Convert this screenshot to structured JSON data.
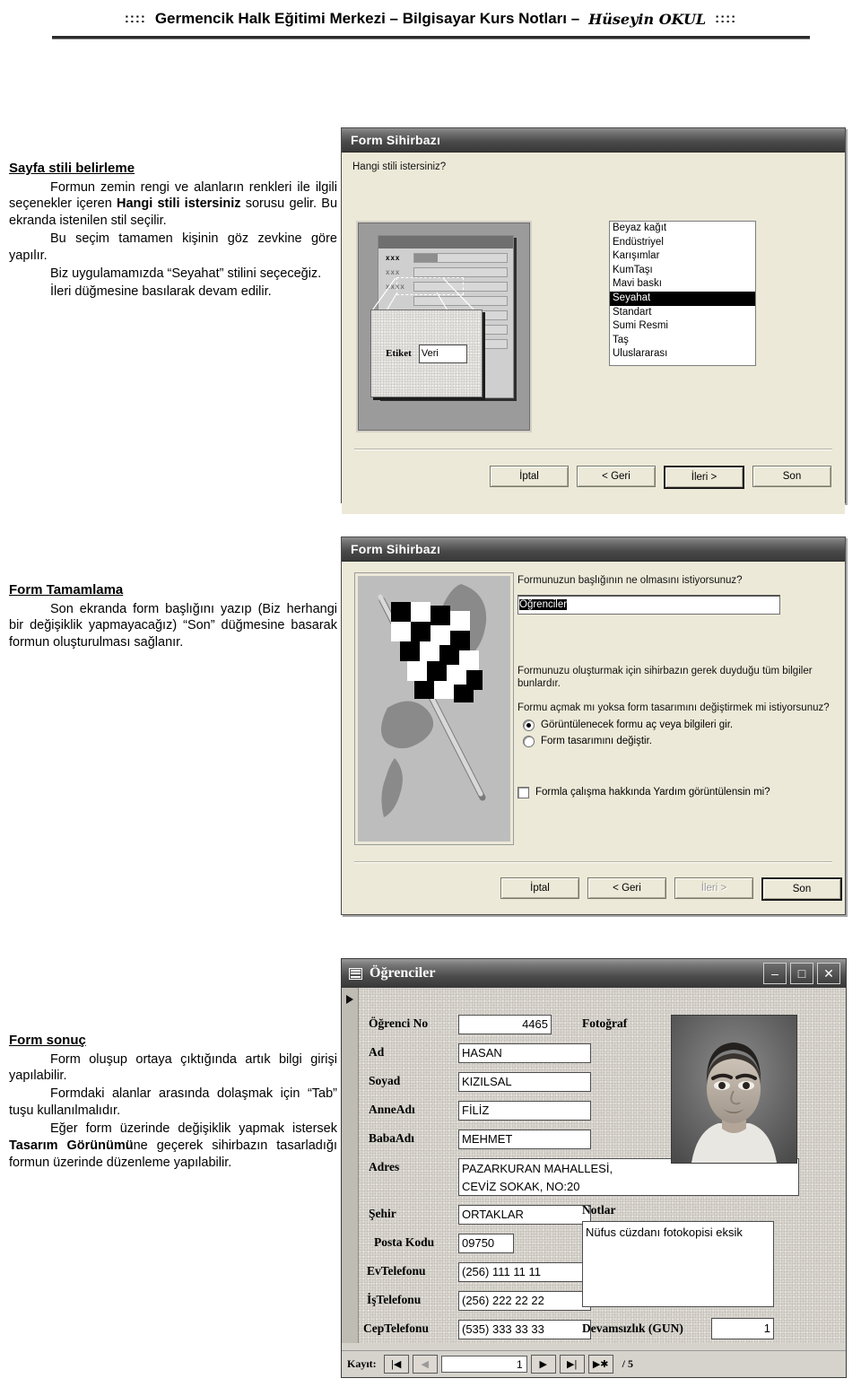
{
  "header": {
    "dots_left": "::::",
    "dots_right": "::::",
    "title": "Germencik Halk Eğitimi Merkezi – Bilgisayar Kurs Notları –",
    "signature": "Hüseyin OKUL"
  },
  "sections": [
    {
      "heading": "Sayfa stili belirleme",
      "paragraphs": [
        "Formun zemin rengi ve alanların renkleri ile ilgili seçenekler içeren Hangi stili istersiniz sorusu gelir. Bu ekranda istenilen stil seçilir.",
        "Bu seçim tamamen kişinin göz zevkine göre yapılır.",
        "Biz uygulamamızda “Seyahat” stilini seçeceğiz.",
        "İleri düğmesine basılarak devam edilir."
      ]
    },
    {
      "heading": "Form Tamamlama",
      "paragraphs": [
        "Son ekranda form başlığını yazıp (Biz herhangi bir değişiklik yapmayacağız) “Son” düğmesine basarak formun oluşturulması sağlanır."
      ]
    },
    {
      "heading": "Form sonuç",
      "paragraphs": [
        "Form oluşup ortaya çıktığında artık bilgi girişi yapılabilir.",
        "Formdaki alanlar arasında dolaşmak için “Tab” tuşu kullanılmalıdır.",
        "Eğer form üzerinde değişiklik yapmak istersek Tasarım Görünümüne geçerek sihirbazın tasarladığı formun üzerinde düzenleme yapılabilir."
      ]
    }
  ],
  "style_wizard": {
    "title": "Form Sihirbazı",
    "question": "Hangi stili istersiniz?",
    "preview": {
      "label_marks": [
        "xxx",
        "xxx",
        "xxxx"
      ],
      "zoom_label": "Etiket",
      "zoom_value": "Veri"
    },
    "styles": [
      "Beyaz kağıt",
      "Endüstriyel",
      "Karışımlar",
      "KumTaşı",
      "Mavi baskı",
      "Seyahat",
      "Standart",
      "Sumi Resmi",
      "Taş",
      "Uluslararası"
    ],
    "selected_style": "Seyahat",
    "buttons": [
      {
        "label": "İptal",
        "state": "normal"
      },
      {
        "label": "< Geri",
        "state": "normal"
      },
      {
        "label": "İleri >",
        "state": "default"
      },
      {
        "label": "Son",
        "state": "normal"
      }
    ]
  },
  "finish_wizard": {
    "title": "Form Sihirbazı",
    "question": "Formunuzun başlığının ne olmasını istiyorsunuz?",
    "title_value": "Öğrenciler",
    "info1": "Formunuzu oluşturmak için sihirbazın gerek duyduğu tüm bilgiler bunlardır.",
    "info2": "Formu açmak mı yoksa form tasarımını değiştirmek mi istiyorsunuz?",
    "radio_open": "Görüntülenecek formu aç veya bilgileri gir.",
    "radio_design": "Form tasarımını değiştir.",
    "selected_radio": "open",
    "help_checkbox": "Formla çalışma hakkında Yardım görüntülensin mi?",
    "help_checked": false,
    "buttons": [
      {
        "label": "İptal",
        "state": "normal"
      },
      {
        "label": "< Geri",
        "state": "normal"
      },
      {
        "label": "İleri >",
        "state": "disabled"
      },
      {
        "label": "Son",
        "state": "default"
      }
    ]
  },
  "access_form": {
    "title": "Öğrenciler",
    "window_buttons": {
      "minimize": "–",
      "maximize": "□",
      "close": "✕"
    },
    "fields": [
      {
        "label": "Öğrenci No",
        "value": "4465"
      },
      {
        "label": "Ad",
        "value": "HASAN"
      },
      {
        "label": "Soyad",
        "value": "KIZILSAL"
      },
      {
        "label": "AnneAdı",
        "value": "FİLİZ"
      },
      {
        "label": "BabaAdı",
        "value": "MEHMET"
      },
      {
        "label": "Adres",
        "value": "PAZARKURAN MAHALLESİ,\nCEVİZ SOKAK, NO:20"
      },
      {
        "label": "Şehir",
        "value": "ORTAKLAR"
      },
      {
        "label": "Posta Kodu",
        "value": "09750"
      },
      {
        "label": "EvTelefonu",
        "value": "(256) 111 11 11"
      },
      {
        "label": "İşTelefonu",
        "value": "(256) 222 22 22"
      },
      {
        "label": "CepTelefonu",
        "value": "(535) 333 33 33"
      }
    ],
    "photo_label": "Fotoğraf",
    "notes_label": "Notlar",
    "notes_value": "Nüfus cüzdanı fotokopisi eksik",
    "absence_label": "Devamsızlık (GUN)",
    "absence_value": "1",
    "nav": {
      "label": "Kayıt:",
      "first": "|◀",
      "prev": "◀",
      "current": "1",
      "next": "▶",
      "last": "▶|",
      "new": "▶✱",
      "total": "/ 5"
    }
  }
}
